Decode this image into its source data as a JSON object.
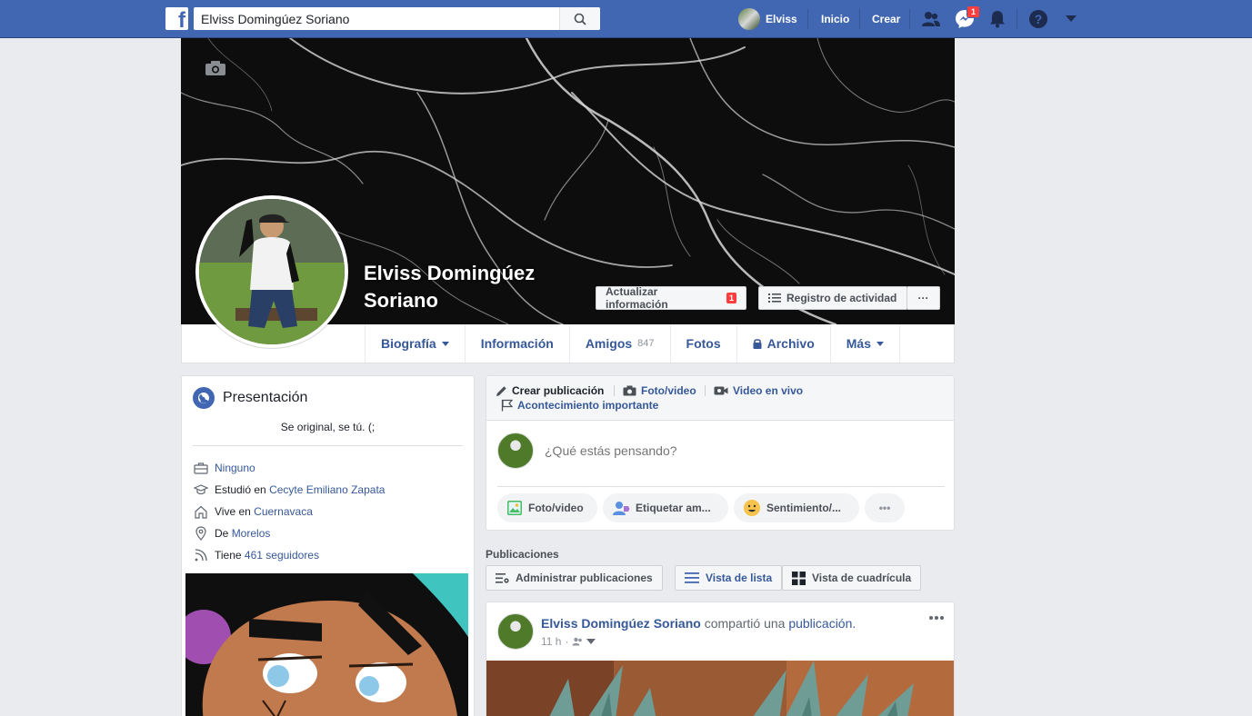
{
  "topbar": {
    "search_value": "Elviss Domingúez Soriano",
    "user_name": "Elviss",
    "home_label": "Inicio",
    "create_label": "Crear",
    "messenger_badge": "1",
    "accent": "#4267b2"
  },
  "profile": {
    "name": "Elviss Domingúez Soriano",
    "update_info_label": "Actualizar información",
    "update_info_badge": "1",
    "activity_log_label": "Registro de actividad",
    "more_label": "···"
  },
  "tabs": [
    {
      "label": "Biografía"
    },
    {
      "label": "Información"
    },
    {
      "label": "Amigos",
      "count": "847"
    },
    {
      "label": "Fotos"
    },
    {
      "label": "Archivo"
    },
    {
      "label": "Más"
    }
  ],
  "intro": {
    "title": "Presentación",
    "bio": "Se original, se tú. (;",
    "work_value": "Ninguno",
    "education_prefix": "Estudió en",
    "education_value": "Cecyte Emiliano Zapata",
    "lives_prefix": "Vive en",
    "lives_value": "Cuernavaca",
    "from_prefix": "De",
    "from_value": "Morelos",
    "followers_prefix": "Tiene",
    "followers_value": "461 seguidores"
  },
  "composer": {
    "tab_create": "Crear publicación",
    "tab_photo": "Foto/video",
    "tab_live": "Video en vivo",
    "tab_event": "Acontecimiento importante",
    "placeholder": "¿Qué estás pensando?",
    "pill_photo": "Foto/video",
    "pill_tag": "Etiquetar am...",
    "pill_feeling": "Sentimiento/...",
    "pill_more": "•••"
  },
  "posts": {
    "section_label": "Publicaciones",
    "manage_label": "Administrar publicaciones",
    "list_view_label": "Vista de lista",
    "grid_view_label": "Vista de cuadrícula"
  },
  "post": {
    "author": "Elviss Domingúez Soriano",
    "action": "compartió una",
    "object": "publicación.",
    "time": "11 h",
    "dot": "·"
  }
}
